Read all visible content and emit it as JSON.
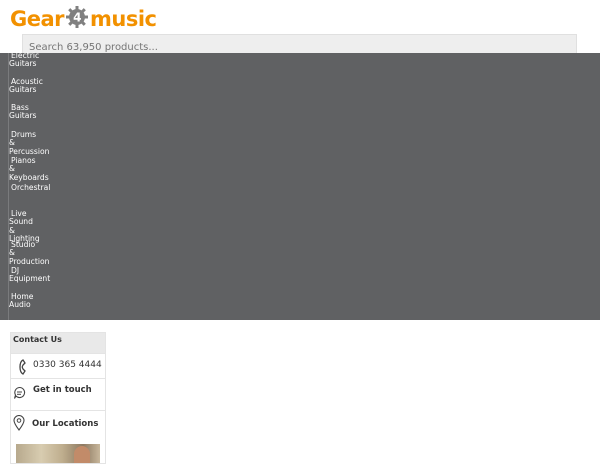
{
  "header": {
    "logo_text_left": "Gear",
    "logo_text_middle": "4",
    "logo_text_right": "music",
    "search_placeholder": "Search 63,950 products..."
  },
  "colors": {
    "brand": "#f29100",
    "overlay": "#606163"
  },
  "nav": {
    "items": [
      {
        "label": "Electric Guitars",
        "lines": [
          "Electric",
          "Guitars"
        ]
      },
      {
        "label": "Acoustic Guitars",
        "lines": [
          "Acoustic",
          "Guitars"
        ]
      },
      {
        "label": "Bass Guitars",
        "lines": [
          "Bass",
          "Guitars"
        ]
      },
      {
        "label": "Drums & Percussion",
        "lines": [
          "Drums",
          "&",
          "Percussion"
        ]
      },
      {
        "label": "Pianos & Keyboards",
        "lines": [
          "Pianos",
          "&",
          "Keyboards"
        ]
      },
      {
        "label": "Orchestral",
        "lines": [
          "Orchestral"
        ]
      },
      {
        "label": "Live Sound & Lighting",
        "lines": [
          "Live",
          "Sound",
          "&",
          "Lighting"
        ]
      },
      {
        "label": "Studio & Production",
        "lines": [
          "Studio",
          "&",
          "Production"
        ]
      },
      {
        "label": "DJ Equipment",
        "lines": [
          "DJ",
          "Equipment"
        ]
      },
      {
        "label": "Home Audio",
        "lines": [
          "Home",
          "Audio"
        ]
      }
    ]
  },
  "contact": {
    "heading": "Contact Us",
    "phone": "0330 365 4444",
    "get_in_touch": "Get in touch",
    "our_locations": "Our Locations",
    "icons": [
      "phone-icon",
      "chat-icon",
      "location-pin-icon"
    ]
  }
}
